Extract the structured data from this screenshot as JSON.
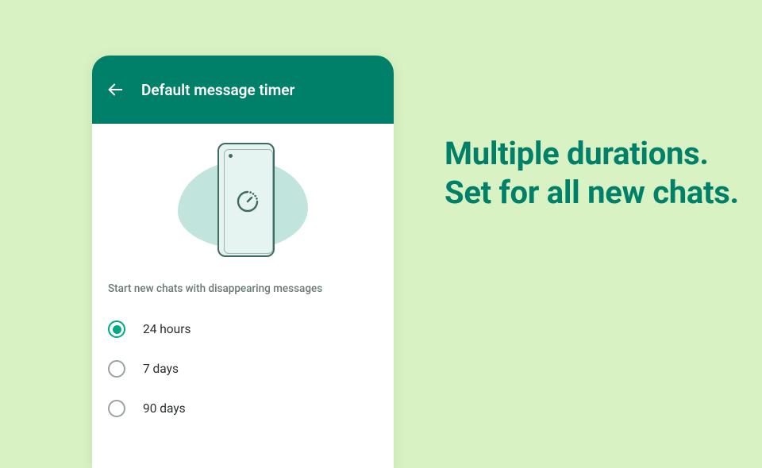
{
  "app_bar": {
    "title": "Default message timer"
  },
  "section_label": "Start new chats with disappearing messages",
  "options": [
    {
      "label": "24 hours",
      "selected": true
    },
    {
      "label": "7 days",
      "selected": false
    },
    {
      "label": "90 days",
      "selected": false
    }
  ],
  "headline": "Multiple durations.\nSet for all new chats.",
  "colors": {
    "background": "#d8f2c4",
    "primary": "#008069",
    "accent": "#00a884"
  }
}
